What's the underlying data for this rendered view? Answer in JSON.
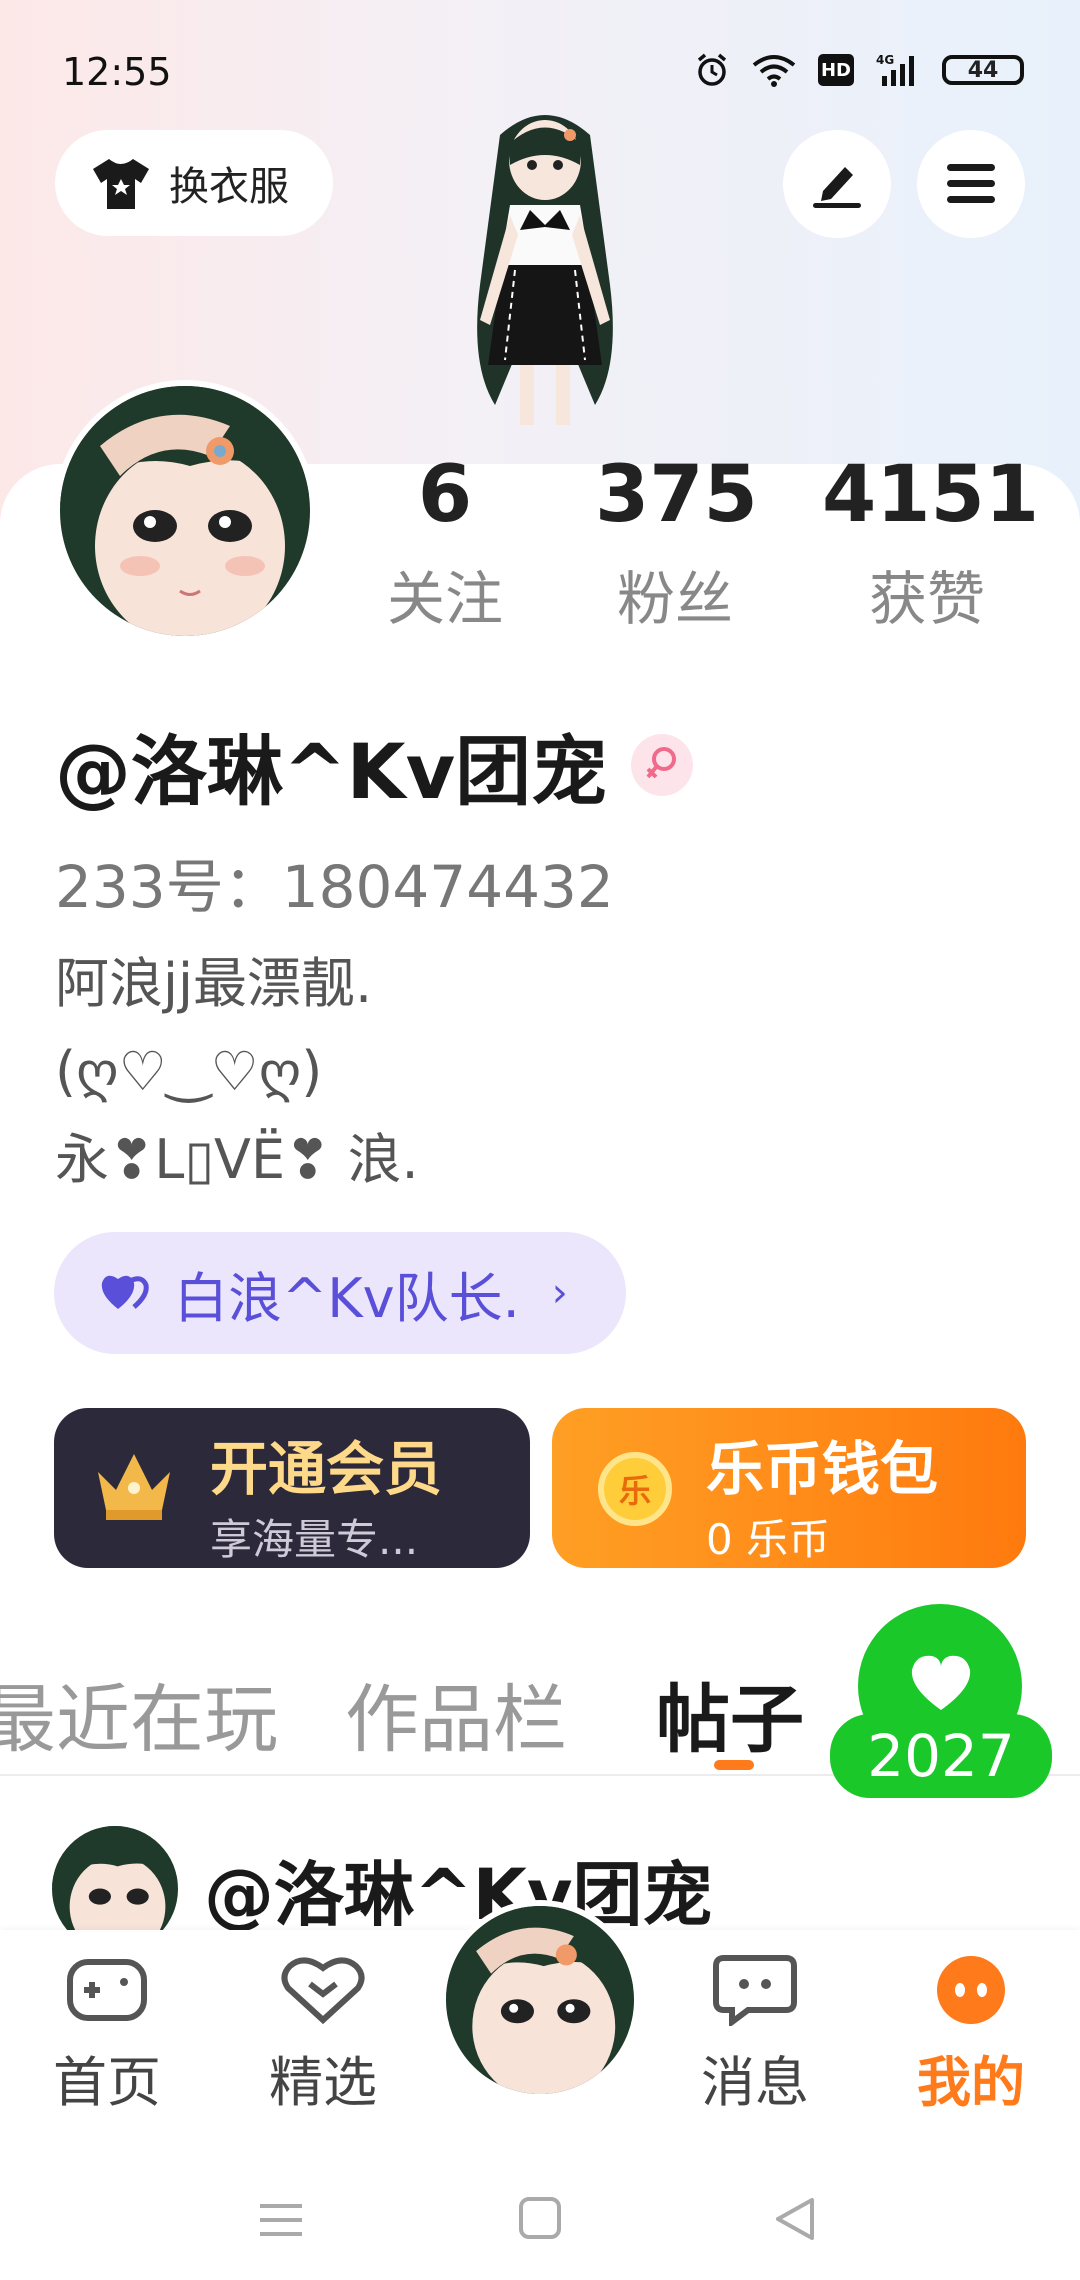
{
  "status_bar": {
    "time": "12:55",
    "battery": "44"
  },
  "header": {
    "outfit_label": "换衣服"
  },
  "stats": [
    {
      "num": "6",
      "label": "关注"
    },
    {
      "num": "375",
      "label": "粉丝"
    },
    {
      "num": "4151",
      "label": "获赞"
    }
  ],
  "profile": {
    "name": "@洛琳^Kv团宠",
    "uid": "233号：180474432",
    "bio": "阿浪jj最漂靓.\n(ღ♡‿♡ღ)\n永❣L▯VË❣ 浪.",
    "team_label": "白浪^Kv队长."
  },
  "vip": {
    "title": "开通会员",
    "subtitle": "享海量专..."
  },
  "wallet": {
    "title": "乐币钱包",
    "subtitle": "0 乐币",
    "coin_char": "乐"
  },
  "tabs": [
    "最近在玩",
    "作品栏",
    "帖子"
  ],
  "like_count": "2027",
  "post": {
    "author": "@洛琳^Kv团宠"
  },
  "bottom_nav": [
    "首页",
    "精选",
    "消息",
    "我的"
  ],
  "colors": {
    "accent": "#ff7a1a",
    "like_green": "#1ac82a",
    "team_purple": "#5a4fd8"
  },
  "icons": [
    "alarm-icon",
    "wifi-icon",
    "hd-icon",
    "signal-icon",
    "battery-icon",
    "shirt-icon",
    "edit-icon",
    "menu-icon",
    "female-icon",
    "heart-icon",
    "crown-icon",
    "coin-icon",
    "gamepad-icon",
    "heart-select-icon",
    "message-icon",
    "more-icon"
  ]
}
